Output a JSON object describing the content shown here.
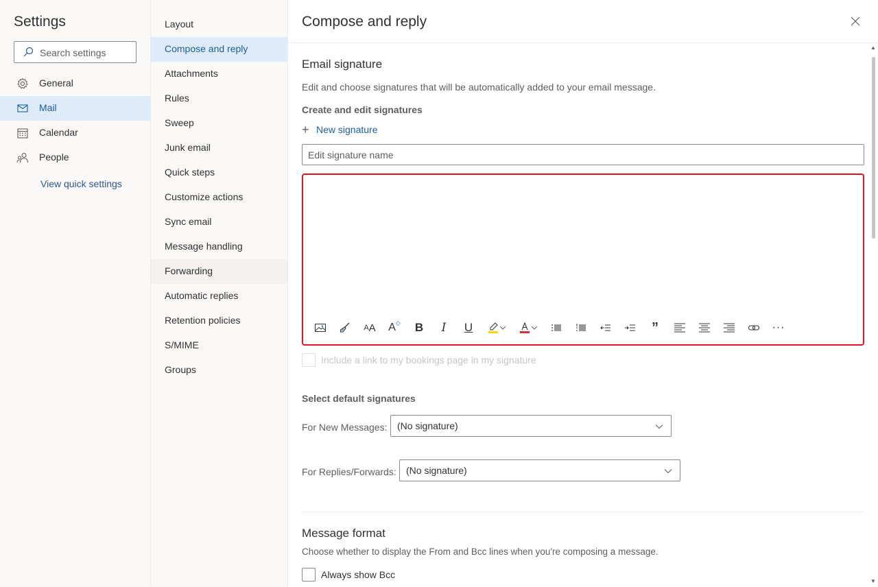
{
  "settings": {
    "title": "Settings",
    "search_placeholder": "Search settings",
    "nav": [
      {
        "label": "General",
        "icon": "gear-icon"
      },
      {
        "label": "Mail",
        "icon": "mail-icon"
      },
      {
        "label": "Calendar",
        "icon": "calendar-icon"
      },
      {
        "label": "People",
        "icon": "people-icon"
      }
    ],
    "quick_settings": "View quick settings"
  },
  "mail_nav": [
    "Layout",
    "Compose and reply",
    "Attachments",
    "Rules",
    "Sweep",
    "Junk email",
    "Quick steps",
    "Customize actions",
    "Sync email",
    "Message handling",
    "Forwarding",
    "Automatic replies",
    "Retention policies",
    "S/MIME",
    "Groups"
  ],
  "panel": {
    "title": "Compose and reply",
    "signature": {
      "heading": "Email signature",
      "description": "Edit and choose signatures that will be automatically added to your email message.",
      "create_heading": "Create and edit signatures",
      "new_signature": "New signature",
      "name_placeholder": "Edit signature name",
      "bookings_label": "Include a link to my bookings page in my signature"
    },
    "defaults": {
      "heading": "Select default signatures",
      "new_messages_label": "For New Messages:",
      "new_messages_value": "(No signature)",
      "replies_label": "For Replies/Forwards:",
      "replies_value": "(No signature)"
    },
    "format": {
      "heading": "Message format",
      "description": "Choose whether to display the From and Bcc lines when you're composing a message.",
      "always_bcc": "Always show Bcc"
    }
  },
  "colors": {
    "accent": "#1b5ea5",
    "selected_bg": "#deecf9",
    "editor_border": "#e81123",
    "highlight": "#ffd700",
    "font_color": "#d13438"
  }
}
